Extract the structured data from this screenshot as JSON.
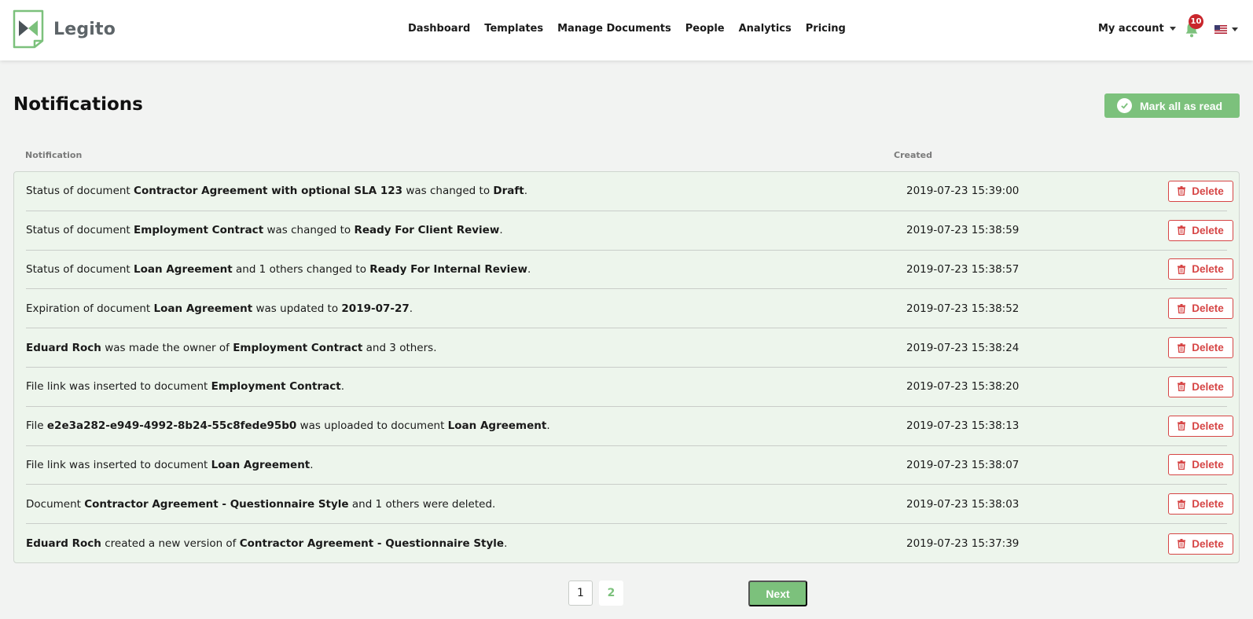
{
  "app": {
    "name": "Legito"
  },
  "nav": [
    "Dashboard",
    "Templates",
    "Manage Documents",
    "People",
    "Analytics",
    "Pricing"
  ],
  "account": {
    "label": "My account",
    "notifications_count": "10"
  },
  "page": {
    "title": "Notifications",
    "mark_all_label": "Mark all as read"
  },
  "columns": {
    "notification": "Notification",
    "created": "Created"
  },
  "delete_label": "Delete",
  "notifications": [
    {
      "segments": [
        [
          "Status of document ",
          false
        ],
        [
          "Contractor Agreement with optional SLA 123",
          true
        ],
        [
          " was changed to ",
          false
        ],
        [
          "Draft",
          true
        ],
        [
          ".",
          false
        ]
      ],
      "created": "2019-07-23 15:39:00"
    },
    {
      "segments": [
        [
          "Status of document ",
          false
        ],
        [
          "Employment Contract",
          true
        ],
        [
          " was changed to ",
          false
        ],
        [
          "Ready For Client Review",
          true
        ],
        [
          ".",
          false
        ]
      ],
      "created": "2019-07-23 15:38:59"
    },
    {
      "segments": [
        [
          "Status of document ",
          false
        ],
        [
          "Loan Agreement",
          true
        ],
        [
          " and 1 others changed to ",
          false
        ],
        [
          "Ready For Internal Review",
          true
        ],
        [
          ".",
          false
        ]
      ],
      "created": "2019-07-23 15:38:57"
    },
    {
      "segments": [
        [
          "Expiration of document ",
          false
        ],
        [
          "Loan Agreement",
          true
        ],
        [
          " was updated to ",
          false
        ],
        [
          "2019-07-27",
          true
        ],
        [
          ".",
          false
        ]
      ],
      "created": "2019-07-23 15:38:52"
    },
    {
      "segments": [
        [
          "Eduard Roch",
          true
        ],
        [
          " was made the owner of ",
          false
        ],
        [
          "Employment Contract",
          true
        ],
        [
          " and 3 others.",
          false
        ]
      ],
      "created": "2019-07-23 15:38:24"
    },
    {
      "segments": [
        [
          "File link was inserted to document ",
          false
        ],
        [
          "Employment Contract",
          true
        ],
        [
          ".",
          false
        ]
      ],
      "created": "2019-07-23 15:38:20"
    },
    {
      "segments": [
        [
          "File ",
          false
        ],
        [
          "e2e3a282-e949-4992-8b24-55c8fede95b0",
          true
        ],
        [
          " was uploaded to document ",
          false
        ],
        [
          "Loan Agreement",
          true
        ],
        [
          ".",
          false
        ]
      ],
      "created": "2019-07-23 15:38:13"
    },
    {
      "segments": [
        [
          "File link was inserted to document ",
          false
        ],
        [
          "Loan Agreement",
          true
        ],
        [
          ".",
          false
        ]
      ],
      "created": "2019-07-23 15:38:07"
    },
    {
      "segments": [
        [
          "Document ",
          false
        ],
        [
          "Contractor Agreement - Questionnaire Style",
          true
        ],
        [
          " and 1 others were deleted.",
          false
        ]
      ],
      "created": "2019-07-23 15:38:03"
    },
    {
      "segments": [
        [
          "Eduard Roch",
          true
        ],
        [
          " created a new version of ",
          false
        ],
        [
          "Contractor Agreement - Questionnaire Style",
          true
        ],
        [
          ".",
          false
        ]
      ],
      "created": "2019-07-23 15:37:39"
    }
  ],
  "pagination": {
    "pages": [
      "1",
      "2"
    ],
    "current": "1",
    "next_label": "Next"
  },
  "colors": {
    "accent": "#7cc17c",
    "danger": "#d64545",
    "table_bg": "#edf5ec",
    "badge": "#c9262c"
  },
  "icons": {
    "logo": "legito-logo-icon",
    "bell": "bell-icon",
    "flag": "us-flag-icon",
    "check": "check-circle-icon",
    "trash": "trash-icon"
  }
}
